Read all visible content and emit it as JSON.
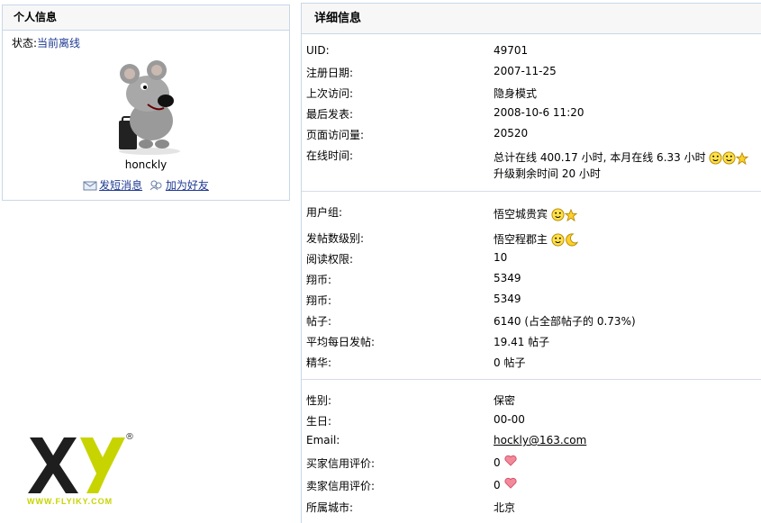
{
  "left_panel": {
    "title": "个人信息",
    "status_label": "状态:",
    "status_value": "当前离线",
    "username": "honckly",
    "actions": {
      "send_message": "发短消息",
      "add_friend": "加为好友"
    }
  },
  "right_panel": {
    "title": "详细信息",
    "section1": [
      {
        "label": "UID:",
        "value": "49701"
      },
      {
        "label": "注册日期:",
        "value": "2007-11-25"
      },
      {
        "label": "上次访问:",
        "value": "隐身模式"
      },
      {
        "label": "最后发表:",
        "value": "2008-10-6 11:20"
      },
      {
        "label": "页面访问量:",
        "value": "20520"
      }
    ],
    "online_time": {
      "label": "在线时间:",
      "line1": "总计在线 400.17 小时, 本月在线 6.33 小时",
      "line2": "升级剩余时间 20 小时"
    },
    "section2": [
      {
        "label": "用户组:",
        "value": "悟空城贵宾"
      },
      {
        "label": "发帖数级别:",
        "value": "悟空程郡主"
      },
      {
        "label": "阅读权限:",
        "value": "10"
      },
      {
        "label": "翔币:",
        "value": "5349"
      },
      {
        "label": "翔币:",
        "value": "5349"
      },
      {
        "label": "帖子:",
        "value": "6140 (占全部帖子的 0.73%)"
      },
      {
        "label": "平均每日发帖:",
        "value": "19.41 帖子"
      },
      {
        "label": "精华:",
        "value": "0 帖子"
      }
    ],
    "section3": [
      {
        "label": "性别:",
        "value": "保密"
      },
      {
        "label": "生日:",
        "value": "00-00"
      },
      {
        "label": "Email:",
        "value": "hockly@163.com"
      },
      {
        "label": "买家信用评价:",
        "value": "0"
      },
      {
        "label": "卖家信用评价:",
        "value": "0"
      },
      {
        "label": "所属城市:",
        "value": "北京"
      }
    ]
  },
  "logo": {
    "text": "XY",
    "registered": "®",
    "url_text": "WWW.FLYIKY.COM"
  },
  "colors": {
    "link": "#1f3a93",
    "border": "#c9d7e8",
    "header_bg": "#f7f7f7",
    "logo_green": "#c8d400"
  }
}
